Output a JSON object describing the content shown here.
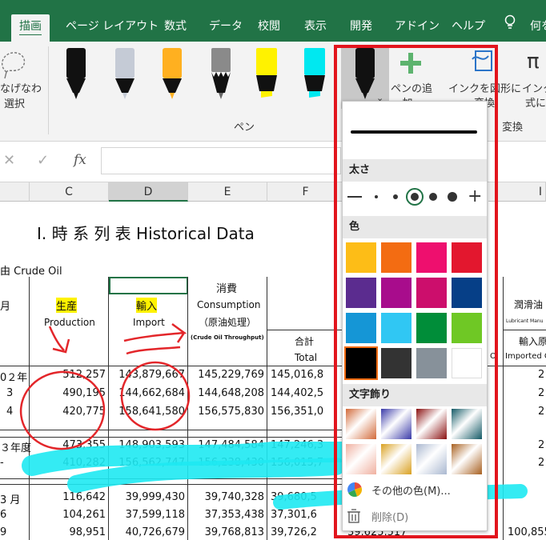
{
  "tabs": [
    "描画",
    "ページ レイアウト",
    "数式",
    "データ",
    "校閲",
    "表示",
    "開発",
    "アドイン",
    "ヘルプ",
    "何を"
  ],
  "ribbon": {
    "lasso": [
      "なげなわ",
      "選択"
    ],
    "add_pen": [
      "ペンの追",
      "加"
    ],
    "ink_to_shape": [
      "インクを図形に",
      "変換"
    ],
    "ink_to_math": [
      "インク",
      "式に"
    ],
    "group_pen": "ペン",
    "group_convert": "変換"
  },
  "formula": {
    "fx": "fx"
  },
  "columns": [
    "C",
    "D",
    "E",
    "F",
    "I"
  ],
  "sheet": {
    "title": "I. 時 系 列 表 Historical Data",
    "subtitle": "由 Crude Oil",
    "shohi": "消費",
    "month": "月",
    "production_jp": "生産",
    "production_en": "Production",
    "import_jp": "輸入",
    "import_en": "Import",
    "consumption_en": "Consumption",
    "consumption_jp": "（原油処理）",
    "consumption_note": "(Crude Oil Throughput)",
    "total_jp": "合計",
    "total_en": "Total",
    "lubricant_jp": "潤滑油",
    "lubricant_en": "Lubricant Manu",
    "import_origin": "輸入原",
    "imported_c": "Imported C",
    "oi": "Oi",
    "rows": [
      {
        "label": "0２年",
        "prod": "512,257",
        "imp": "143,879,667",
        "cons": "145,229,769",
        "total": "145,016,8",
        "frag": "2"
      },
      {
        "label": "3",
        "prod": "490,195",
        "imp": "144,662,684",
        "cons": "144,648,208",
        "total": "144,402,5",
        "frag": "2"
      },
      {
        "label": "4",
        "prod": "420,775",
        "imp": "158,641,580",
        "cons": "156,575,830",
        "total": "156,351,0",
        "frag": "2"
      },
      {
        "label": "３年度",
        "prod": "473,355",
        "imp": "148,903,593",
        "cons": "147,484,584",
        "total": "147,246,3",
        "frag": "2"
      },
      {
        "label": "-",
        "prod": "410,282",
        "imp": "156,562,747",
        "cons": "156,238,430",
        "total": "156,015,7",
        "frag": "2"
      },
      {
        "label": "3 月",
        "prod": "116,642",
        "imp": "39,999,430",
        "cons": "39,740,328",
        "total": "39,680,5",
        "frag": ""
      },
      {
        "label": "6",
        "prod": "104,261",
        "imp": "37,599,118",
        "cons": "37,353,438",
        "total": "37,301,6",
        "frag": ""
      },
      {
        "label": "9",
        "prod": "98,951",
        "imp": "40,726,679",
        "cons": "39,768,813",
        "total": "39,726,2",
        "frag": "100,855"
      }
    ],
    "bottom_extra": "39,625,517"
  },
  "dropdown": {
    "thickness": "太さ",
    "color": "色",
    "effects": "文字飾り",
    "more_colors": "その他の色(M)...",
    "delete": "削除(D)",
    "colors": [
      "#fdbd17",
      "#f36c12",
      "#ee0f6e",
      "#e3172e",
      "#5b2c8f",
      "#a80c8c",
      "#cc0e6c",
      "#063f87",
      "#1596d6",
      "#30c7f3",
      "#008d39",
      "#6fc825",
      "#000000",
      "#333333",
      "#87919a",
      "#ffffff"
    ],
    "effect_colors": [
      "#d26a3a",
      "#3a3aa8",
      "#8a1010",
      "#145a66",
      "#f0b0a0",
      "#d9a020",
      "#aab8d0",
      "#a86020"
    ]
  },
  "colors": {
    "accent": "#217346",
    "highlight_box": "#e2151d",
    "ink_red": "#e3262a",
    "ink_cyan": "#1ee9f2"
  }
}
